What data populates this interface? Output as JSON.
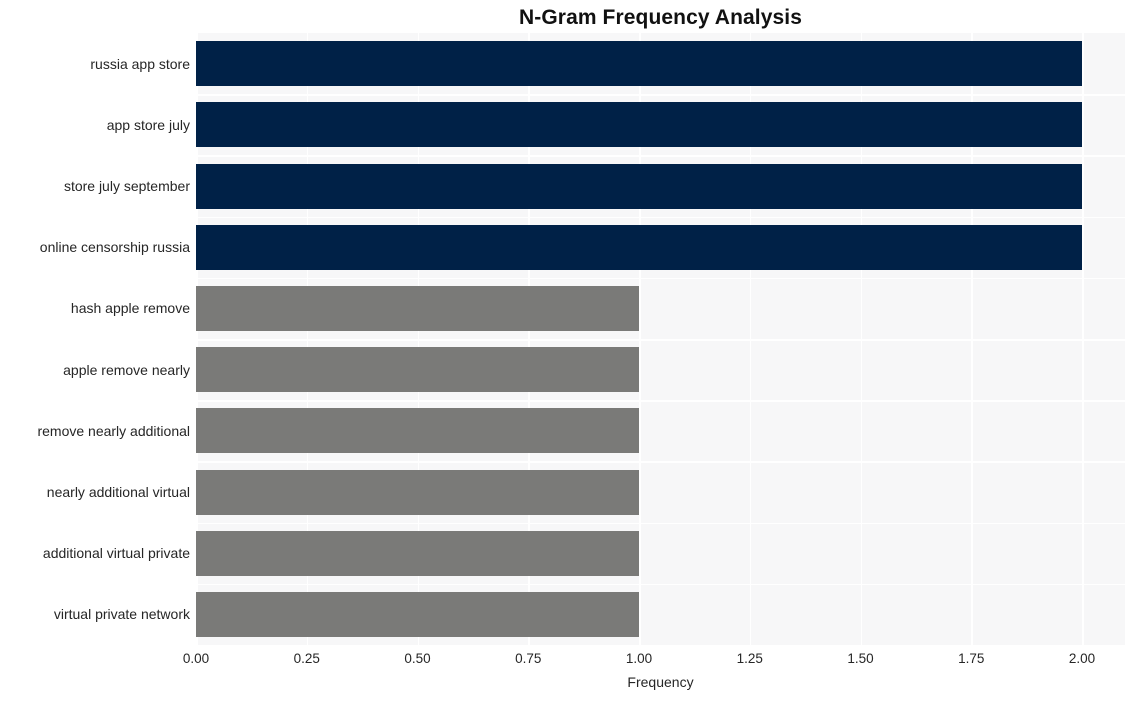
{
  "chart_data": {
    "type": "bar",
    "orientation": "horizontal",
    "title": "N-Gram Frequency Analysis",
    "xlabel": "Frequency",
    "ylabel": "",
    "xlim": [
      0,
      2.0
    ],
    "ylim": [
      0,
      10
    ],
    "grid": true,
    "legend": null,
    "categories": [
      "russia app store",
      "app store july",
      "store july september",
      "online censorship russia",
      "hash apple remove",
      "apple remove nearly",
      "remove nearly additional",
      "nearly additional virtual",
      "additional virtual private",
      "virtual private network"
    ],
    "values": [
      2,
      2,
      2,
      2,
      1,
      1,
      1,
      1,
      1,
      1
    ],
    "bar_colors": [
      "#002147",
      "#002147",
      "#002147",
      "#002147",
      "#7a7a78",
      "#7a7a78",
      "#7a7a78",
      "#7a7a78",
      "#7a7a78",
      "#7a7a78"
    ],
    "xticks": [
      "0.00",
      "0.25",
      "0.50",
      "0.75",
      "1.00",
      "1.25",
      "1.50",
      "1.75",
      "2.00"
    ],
    "xtick_values": [
      0,
      0.25,
      0.5,
      0.75,
      1.0,
      1.25,
      1.5,
      1.75,
      2.0
    ],
    "colors": {
      "plot_background": "#f7f7f8",
      "figure_background": "#ffffff",
      "gridline": "#ffffff",
      "primary_bar": "#002147",
      "secondary_bar": "#7a7a78",
      "text": "#262626",
      "title": "#111111"
    }
  }
}
